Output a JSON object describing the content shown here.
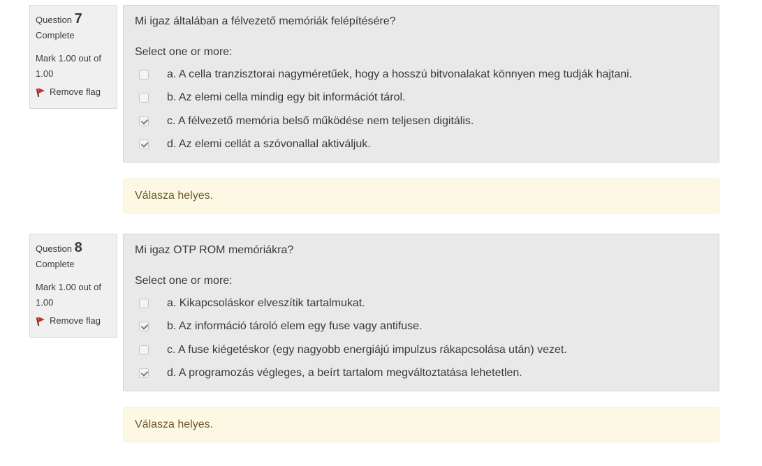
{
  "questions": [
    {
      "label": "Question",
      "number": "7",
      "state": "Complete",
      "grade": "Mark 1.00 out of 1.00",
      "flag_label": "Remove flag",
      "text": "Mi igaz általában a félvezető memóriák felépítésére?",
      "prompt": "Select one or more:",
      "answers": [
        {
          "text": "a. A cella tranzisztorai nagyméretűek, hogy a hosszú bitvonalakat könnyen meg tudják hajtani.",
          "checked": false
        },
        {
          "text": "b. Az elemi cella mindig egy bit információt tárol.",
          "checked": false
        },
        {
          "text": "c. A félvezető memória belső működése nem teljesen digitális.",
          "checked": true
        },
        {
          "text": "d. Az elemi cellát a szóvonallal aktiváljuk.",
          "checked": true
        }
      ],
      "feedback": "Válasza helyes."
    },
    {
      "label": "Question",
      "number": "8",
      "state": "Complete",
      "grade": "Mark 1.00 out of 1.00",
      "flag_label": "Remove flag",
      "text": "Mi igaz OTP ROM memóriákra?",
      "prompt": "Select one or more:",
      "answers": [
        {
          "text": "a. Kikapcsoláskor elveszítik tartalmukat.",
          "checked": false
        },
        {
          "text": "b. Az információ tároló elem egy fuse vagy antifuse.",
          "checked": true
        },
        {
          "text": "c. A fuse kiégetéskor (egy nagyobb energiájú impulzus rákapcsolása után) vezet.",
          "checked": false
        },
        {
          "text": "d. A programozás végleges, a beírt tartalom megváltoztatása lehetetlen.",
          "checked": true
        }
      ],
      "feedback": "Válasza helyes."
    }
  ]
}
